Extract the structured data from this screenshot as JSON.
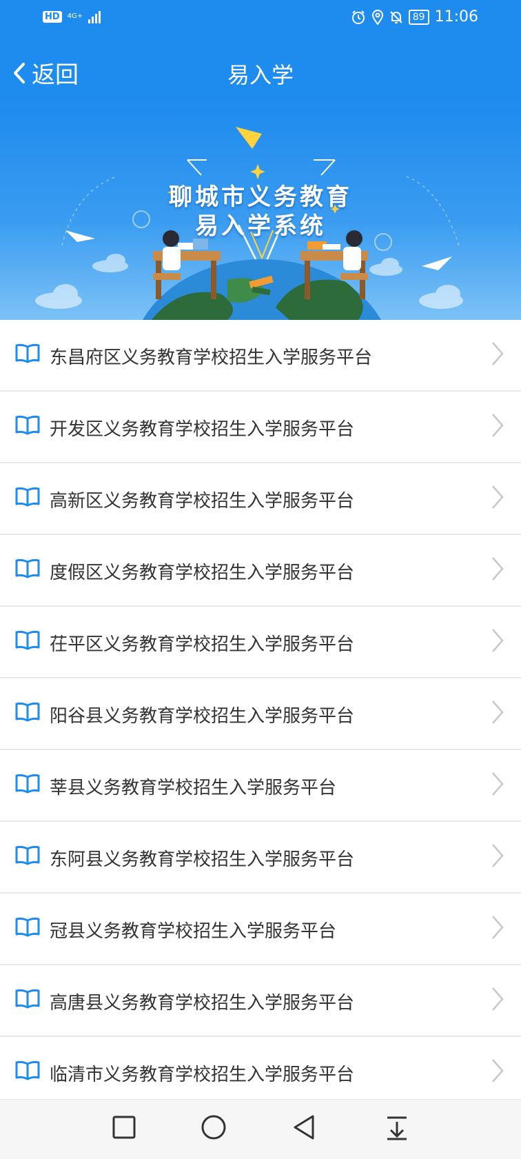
{
  "status_bar": {
    "hd": "HD",
    "network": "4G+",
    "battery": "89",
    "time": "11:06",
    "icons": [
      "alarm-icon",
      "location-icon",
      "mute-icon"
    ]
  },
  "header": {
    "back_label": "返回",
    "title": "易入学"
  },
  "banner": {
    "title": "聊城市义务教育",
    "subtitle": "易入学系统"
  },
  "list": {
    "items": [
      {
        "label": "东昌府区义务教育学校招生入学服务平台"
      },
      {
        "label": "开发区义务教育学校招生入学服务平台"
      },
      {
        "label": "高新区义务教育学校招生入学服务平台"
      },
      {
        "label": "度假区义务教育学校招生入学服务平台"
      },
      {
        "label": "茌平区义务教育学校招生入学服务平台"
      },
      {
        "label": "阳谷县义务教育学校招生入学服务平台"
      },
      {
        "label": "莘县义务教育学校招生入学服务平台"
      },
      {
        "label": "东阿县义务教育学校招生入学服务平台"
      },
      {
        "label": "冠县义务教育学校招生入学服务平台"
      },
      {
        "label": "高唐县义务教育学校招生入学服务平台"
      },
      {
        "label": "临清市义务教育学校招生入学服务平台"
      }
    ]
  },
  "colors": {
    "primary": "#1e8bee",
    "icon": "#1e8bee",
    "text": "#333333",
    "divider": "#e8e8e8"
  },
  "nav_bar": {
    "buttons": [
      "recent-apps-icon",
      "home-icon",
      "back-icon",
      "notification-drawer-icon"
    ]
  }
}
